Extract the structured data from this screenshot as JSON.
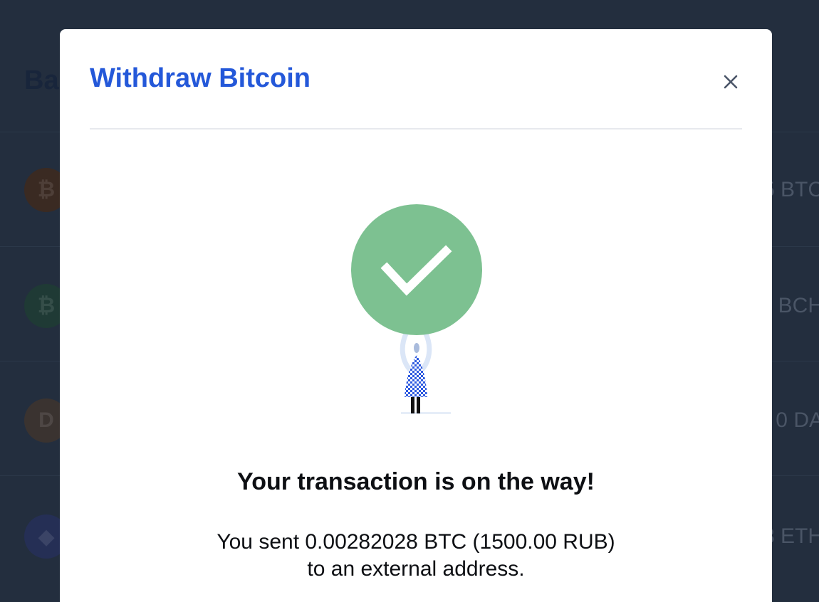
{
  "background": {
    "page_title": "Ba",
    "assets": [
      {
        "icon": "bitcoin-icon",
        "glyph": "₿",
        "color": "#3a2a22",
        "amount": "5 BTC"
      },
      {
        "icon": "bitcoin-cash-icon",
        "glyph": "₿",
        "color": "#1f3a35",
        "amount": "1 BCH"
      },
      {
        "icon": "dai-icon",
        "glyph": "D",
        "color": "#3a3330",
        "amount": "0 DA"
      },
      {
        "icon": "ethereum-icon",
        "glyph": "◆",
        "color": "#252f55",
        "amount": "3 ETH"
      }
    ]
  },
  "modal": {
    "title": "Withdraw Bitcoin",
    "close_icon": "close-icon",
    "illustration": {
      "icon": "checkmark-icon",
      "circle_color": "#7dc191",
      "figure_color": "#2f5be0"
    },
    "heading": "Your transaction is on the way!",
    "message": "You sent 0.00282028 BTC (1500.00 RUB) to an external address."
  }
}
